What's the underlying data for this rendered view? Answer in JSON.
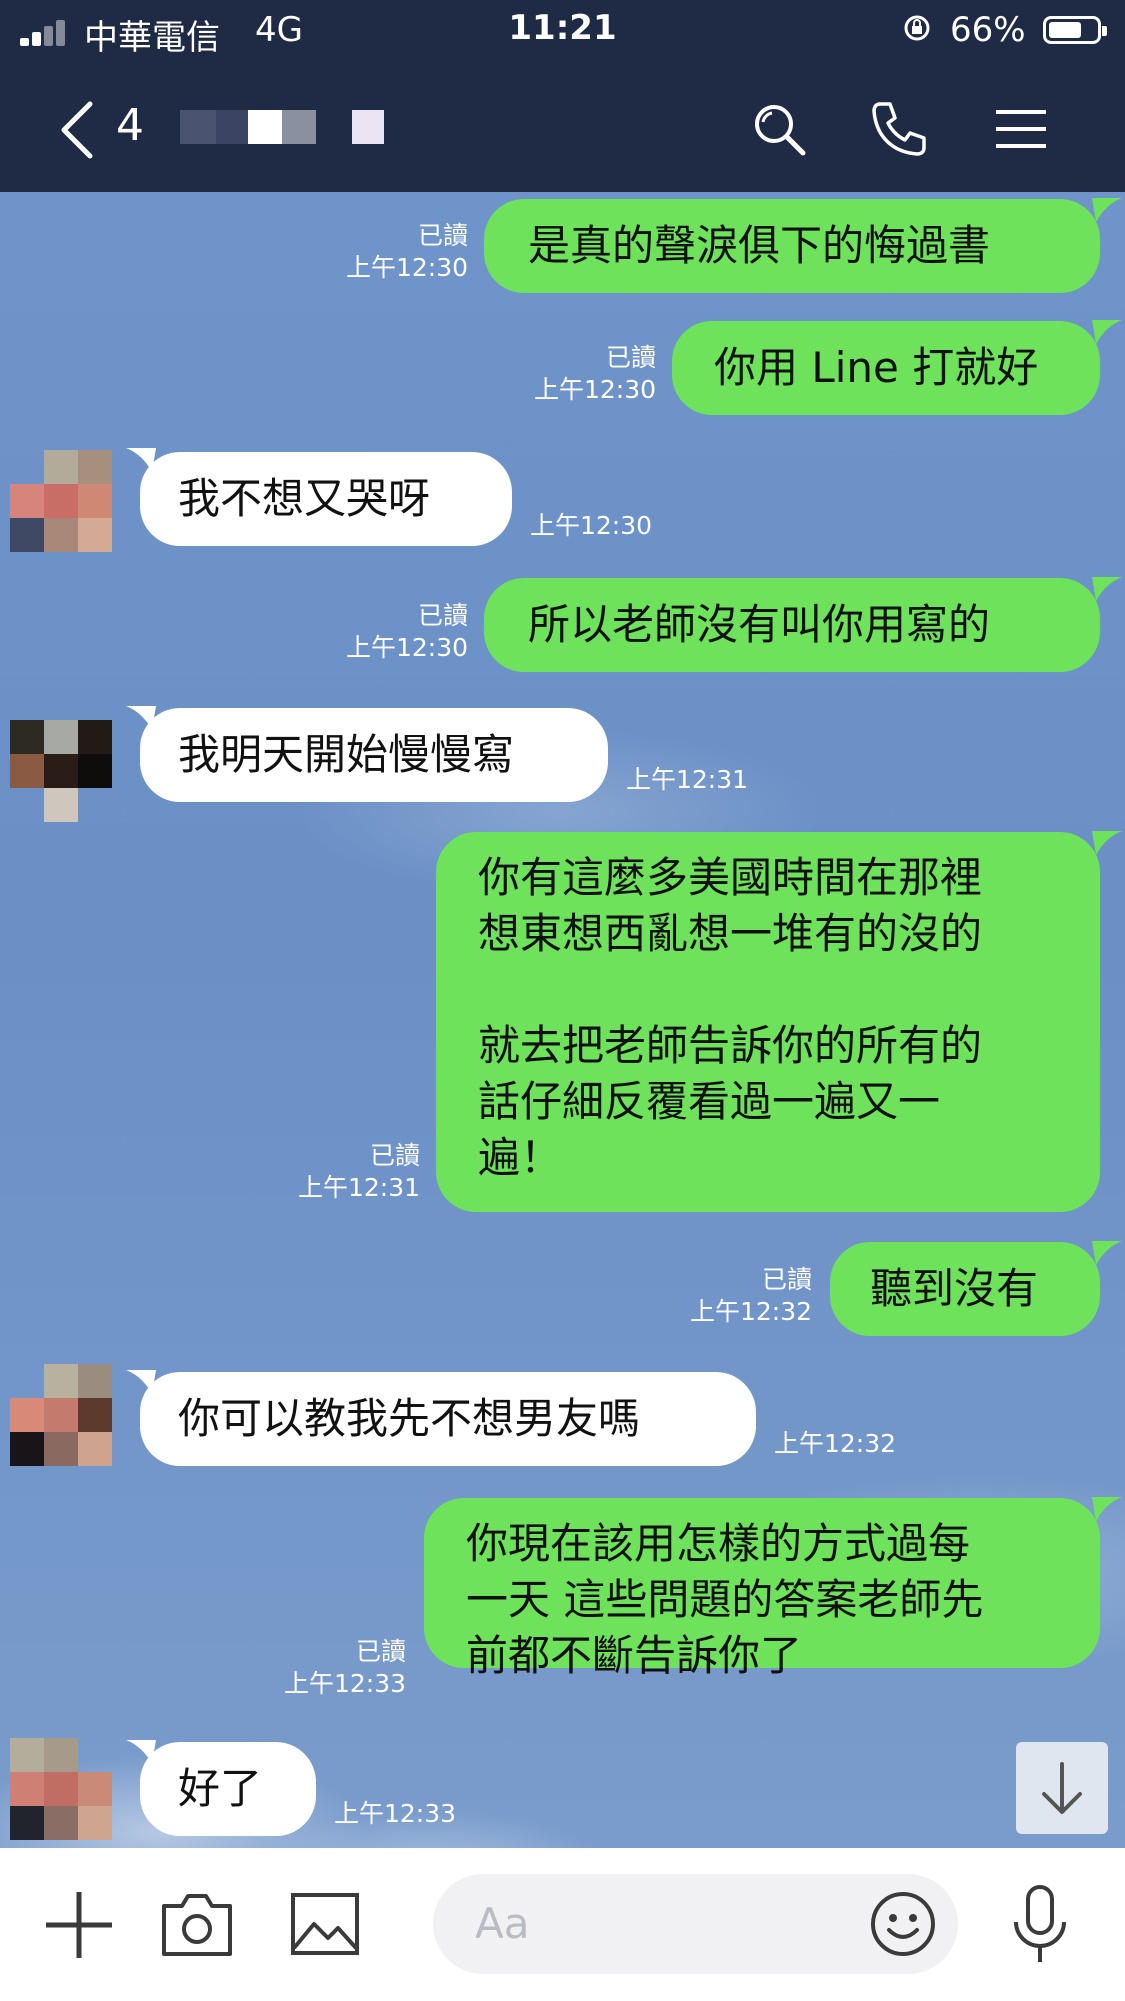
{
  "status": {
    "carrier": "中華電信",
    "network": "4G",
    "time": "11:21",
    "battery": "66%"
  },
  "header": {
    "unread_count": "4"
  },
  "messages": [
    {
      "side": "out",
      "text": "是真的聲淚俱下的悔過書",
      "read": "已讀",
      "time": "上午12:30"
    },
    {
      "side": "out",
      "text": "你用 Line 打就好",
      "read": "已讀",
      "time": "上午12:30"
    },
    {
      "side": "in",
      "text": "我不想又哭呀",
      "time": "上午12:30"
    },
    {
      "side": "out",
      "text": "所以老師沒有叫你用寫的",
      "read": "已讀",
      "time": "上午12:30"
    },
    {
      "side": "in",
      "text": "我明天開始慢慢寫",
      "time": "上午12:31"
    },
    {
      "side": "out",
      "text": "你有這麼多美國時間在那裡\n想東想西亂想一堆有的沒的\n\n就去把老師告訴你的所有的\n話仔細反覆看過一遍又一\n遍！",
      "read": "已讀",
      "time": "上午12:31"
    },
    {
      "side": "out",
      "text": "聽到沒有",
      "read": "已讀",
      "time": "上午12:32"
    },
    {
      "side": "in",
      "text": "你可以教我先不想男友嗎",
      "time": "上午12:32"
    },
    {
      "side": "out",
      "text": "你現在該用怎樣的方式過每\n一天 這些問題的答案老師先\n前都不斷告訴你了",
      "read": "已讀",
      "time": "上午12:33"
    },
    {
      "side": "in",
      "text": "好了",
      "time": "上午12:33"
    }
  ],
  "input": {
    "placeholder": "Aa"
  },
  "icons": {
    "header": [
      "back-chevron-icon",
      "search-icon",
      "phone-icon",
      "menu-icon"
    ],
    "bottom": [
      "plus-icon",
      "camera-icon",
      "image-icon",
      "emoji-icon",
      "microphone-icon"
    ],
    "scroll": "arrow-down-icon"
  },
  "colors": {
    "header": "#1f2a44",
    "outgoing_bubble": "#6ee25a",
    "incoming_bubble": "#ffffff",
    "chat_background": "#6f93c8"
  }
}
